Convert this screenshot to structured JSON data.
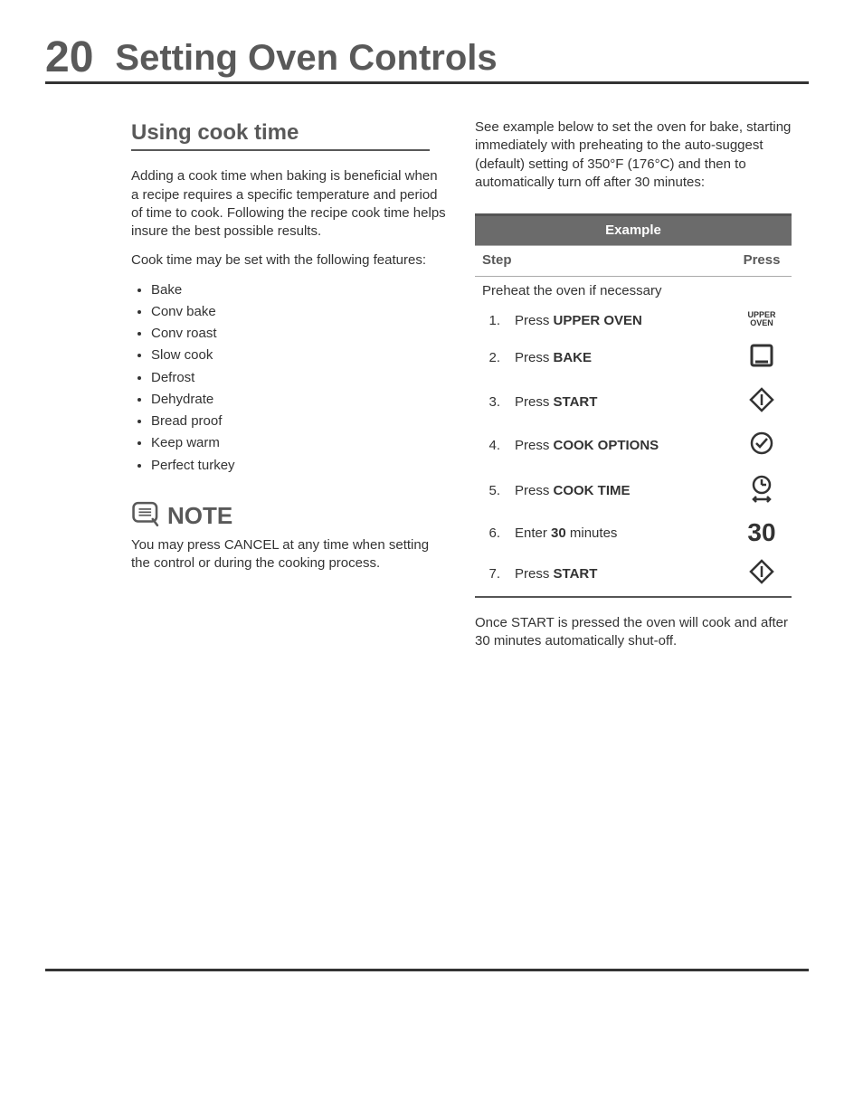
{
  "page_number": "20",
  "title": "Setting Oven Controls",
  "section_heading": "Using cook time",
  "intro": {
    "para1": "Adding a cook time when baking is beneficial when a recipe requires a specific temperature and period of time to cook. Following the recipe cook time helps insure the best possible results.",
    "para2": "Cook time may be set with the following features:"
  },
  "features": [
    "Bake",
    "Conv bake",
    "Conv roast",
    "Slow cook",
    "Defrost",
    "Dehydrate",
    "Bread proof",
    "Keep warm",
    "Perfect turkey"
  ],
  "note": {
    "title": "NOTE",
    "body": "You may press CANCEL at any time when setting the control or during the cooking process."
  },
  "right": {
    "intro": "See example below to set the oven for bake, starting immediately with preheating to the auto-suggest (default) setting of 350°F (176°C) and then to automatically turn off after 30 minutes:",
    "table_header": "Example",
    "col_step": "Step",
    "col_press": "Press",
    "preheat_row": "Preheat the oven if necessary",
    "steps": [
      {
        "num": "1.",
        "pre": "Press ",
        "bold": "UPPER OVEN",
        "post": "",
        "press": "UPPER\nOVEN"
      },
      {
        "num": "2.",
        "pre": "Press ",
        "bold": "BAKE",
        "post": "",
        "press": "bake-icon"
      },
      {
        "num": "3.",
        "pre": "Press ",
        "bold": "START",
        "post": "",
        "press": "start-icon"
      },
      {
        "num": "4.",
        "pre": "Press ",
        "bold": "COOK OPTIONS",
        "post": "",
        "press": "options-icon"
      },
      {
        "num": "5.",
        "pre": "Press ",
        "bold": "COOK TIME",
        "post": "",
        "press": "timer-icon"
      },
      {
        "num": "6.",
        "pre": "Enter ",
        "bold": "30",
        "post": " minutes",
        "press": "30"
      },
      {
        "num": "7.",
        "pre": "Press ",
        "bold": "START",
        "post": "",
        "press": "start-icon"
      }
    ],
    "outro": "Once START is pressed the oven will cook and after 30 minutes automatically shut-off."
  }
}
